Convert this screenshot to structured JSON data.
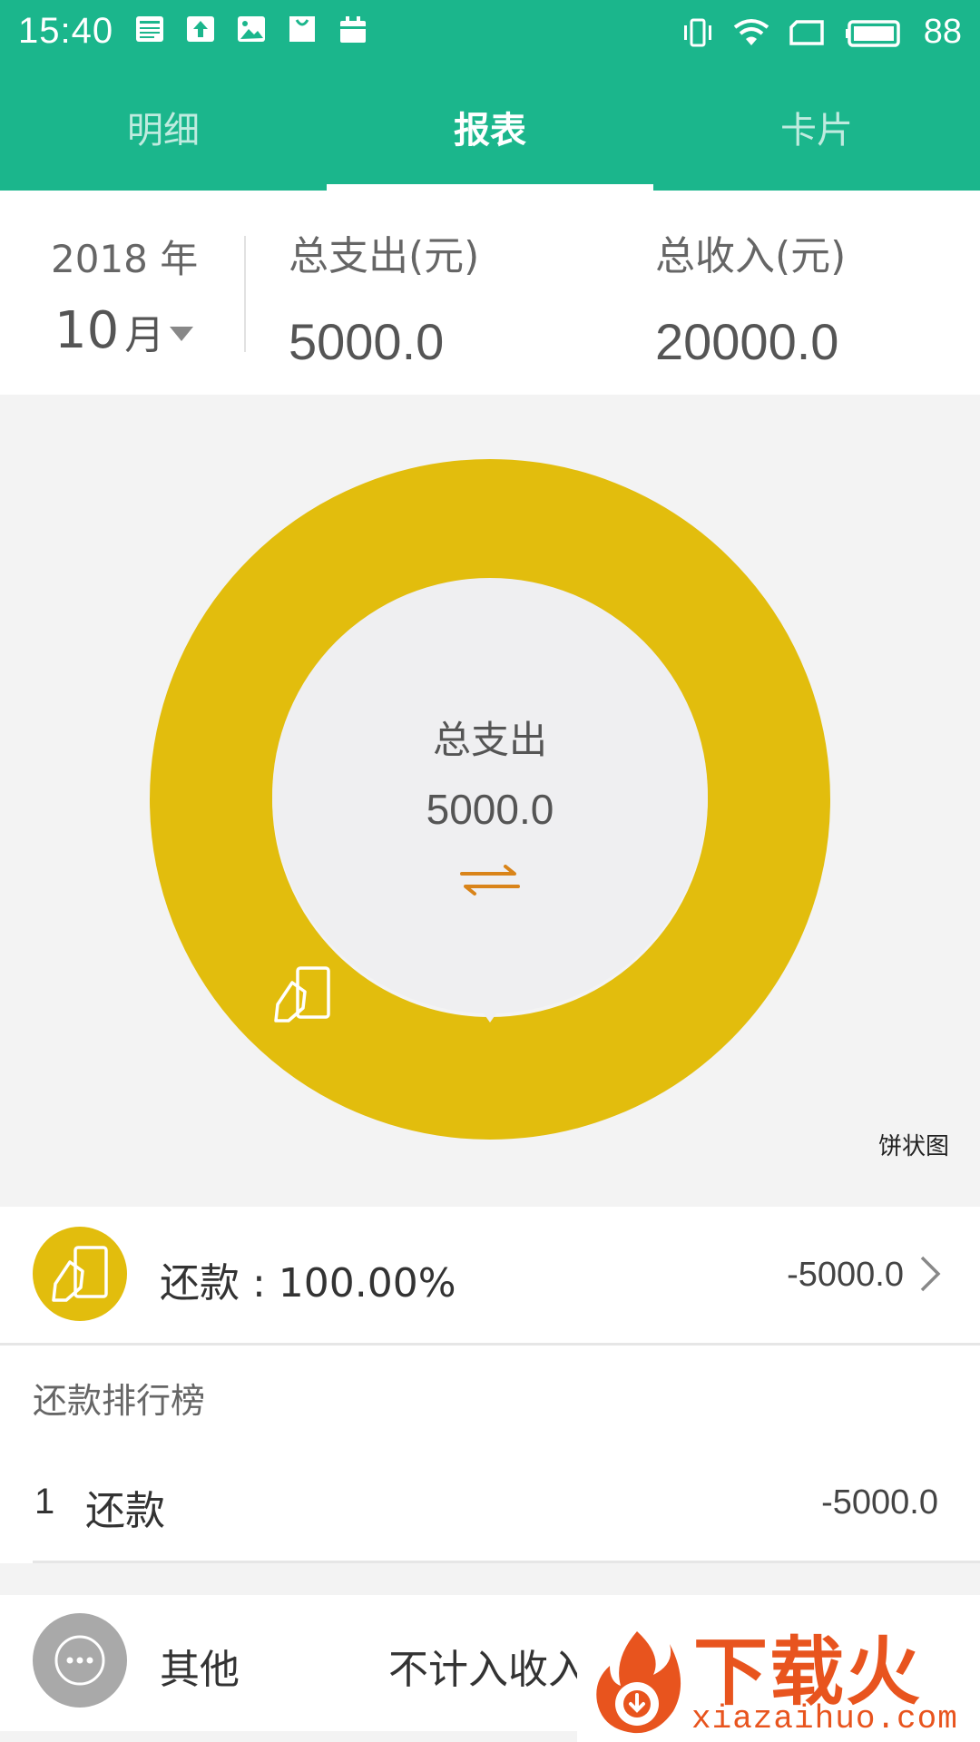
{
  "status_bar": {
    "time": "15:40",
    "battery": "88",
    "left_icons": [
      "news-icon",
      "upload-icon",
      "gallery-icon",
      "shopping-bag-icon",
      "calendar-icon"
    ],
    "right_icons": [
      "vibrate-icon",
      "wifi-icon",
      "sim-icon",
      "battery-icon"
    ]
  },
  "tabs": [
    {
      "label": "明细",
      "active": false
    },
    {
      "label": "报表",
      "active": true
    },
    {
      "label": "卡片",
      "active": false
    }
  ],
  "summary": {
    "year": "2018 年",
    "month_num": "10",
    "month_suffix": "月",
    "expense_label": "总支出(元)",
    "expense_value": "5000.0",
    "income_label": "总收入(元)",
    "income_value": "20000.0"
  },
  "chart": {
    "center_title": "总支出",
    "center_value": "5000.0",
    "chart_type_label": "饼状图",
    "slice_color": "#e2bd0d"
  },
  "chart_data": {
    "type": "pie",
    "categories": [
      "还款"
    ],
    "values": [
      5000.0
    ]
  },
  "category": {
    "label": "还款 : 100.00%",
    "amount": "-5000.0",
    "icon": "card-payment-icon",
    "color": "#e2bd0d"
  },
  "ranking": {
    "title": "还款排行榜",
    "rows": [
      {
        "rank": "1",
        "name": "还款",
        "amount": "-5000.0"
      }
    ]
  },
  "other": {
    "label": "其他",
    "note": "不计入收入"
  },
  "watermark": {
    "brand": "下载火",
    "url": "xiazaihuo.com"
  },
  "colors": {
    "accent": "#1bb68c",
    "slice": "#e2bd0d",
    "brand_watermark": "#e8541e"
  }
}
